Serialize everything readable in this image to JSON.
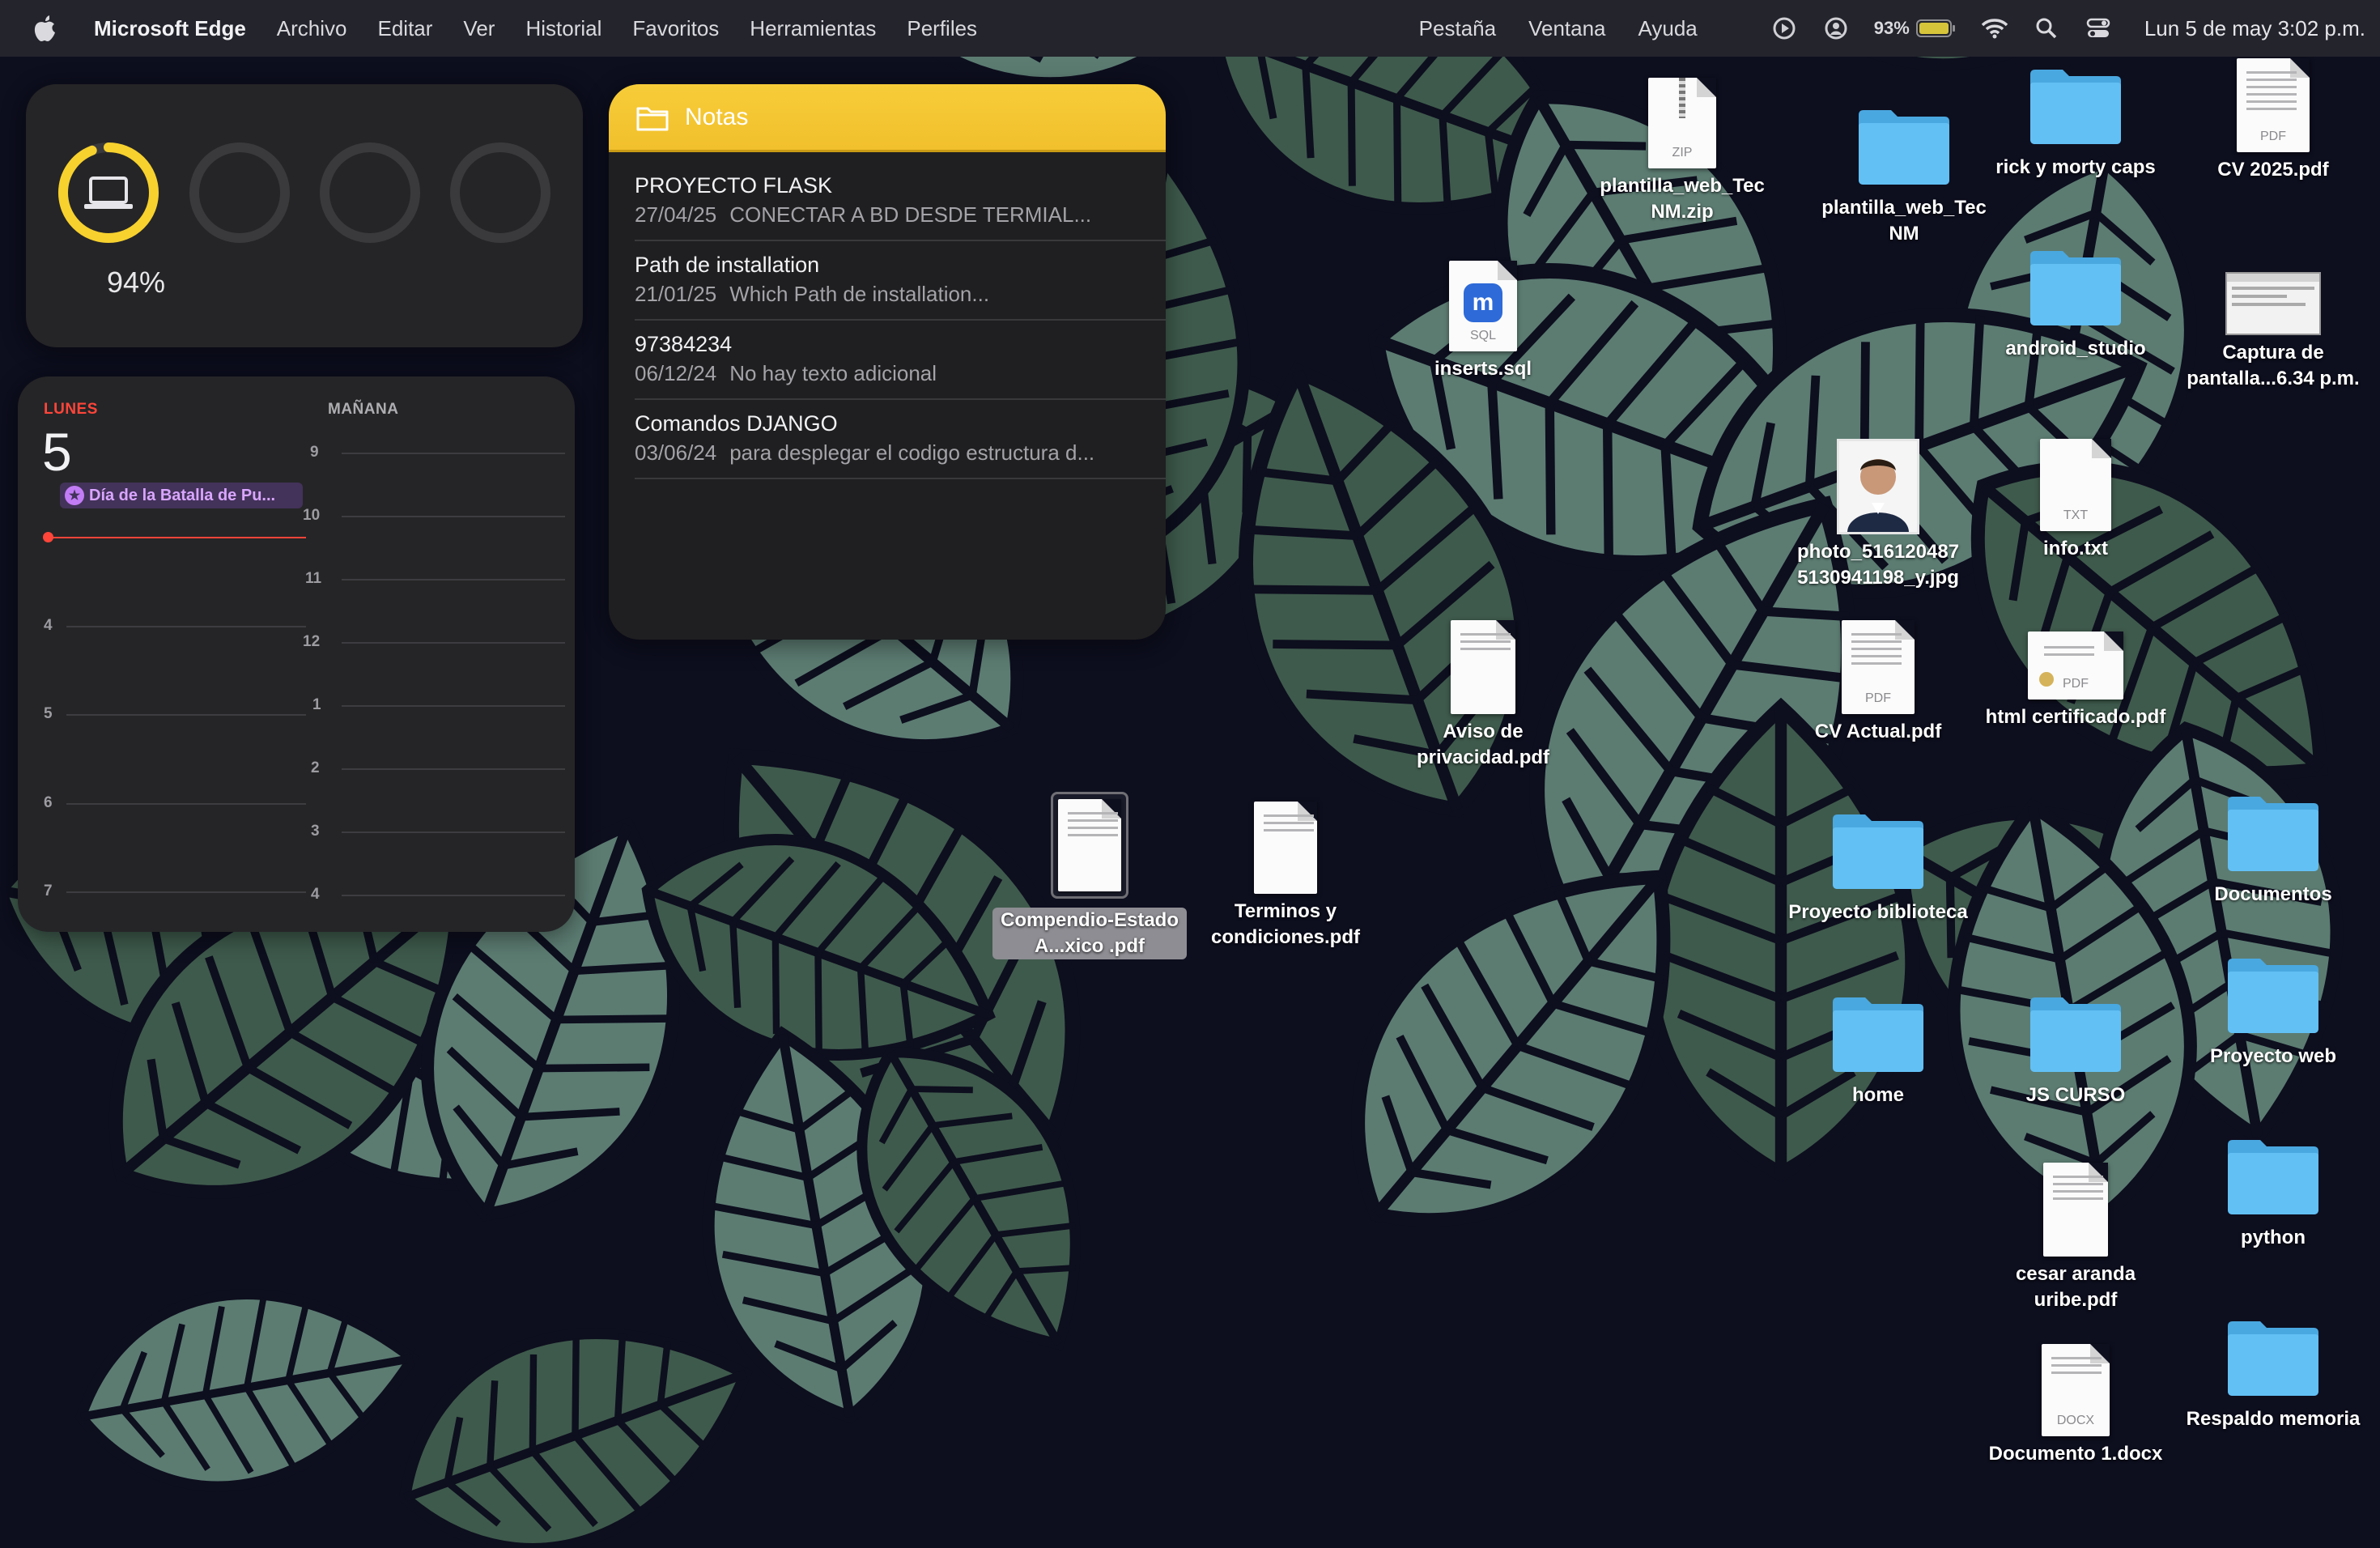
{
  "menubar": {
    "app_name": "Microsoft Edge",
    "menus": [
      "Archivo",
      "Editar",
      "Ver",
      "Historial",
      "Favoritos",
      "Herramientas",
      "Perfiles"
    ],
    "right_menus": [
      "Pestaña",
      "Ventana",
      "Ayuda"
    ],
    "battery_percent": "93%",
    "clock": "Lun 5 de may  3:02 p.m.",
    "icons": [
      "apple-icon",
      "play-icon",
      "user-icon",
      "battery-icon",
      "wifi-icon",
      "search-icon",
      "control-center-icon"
    ]
  },
  "battery_widget": {
    "percent_label": "94%",
    "level": 0.94,
    "ring_color": "#f7d12e"
  },
  "calendar_widget": {
    "today_label": "LUNES",
    "day_number": "5",
    "event": "Día de la Batalla de Pu...",
    "tomorrow_label": "MAÑANA",
    "today_hours": [
      "4",
      "5",
      "6",
      "7"
    ],
    "tomorrow_hours": [
      "9",
      "10",
      "11",
      "12",
      "1",
      "2",
      "3",
      "4"
    ]
  },
  "notes_widget": {
    "title": "Notas",
    "notes": [
      {
        "title": "PROYECTO FLASK",
        "date": "27/04/25",
        "preview": "CONECTAR A BD DESDE TERMIAL..."
      },
      {
        "title": "Path de installation",
        "date": "21/01/25",
        "preview": "Which Path de installation..."
      },
      {
        "title": "97384234",
        "date": "06/12/24",
        "preview": "No hay texto adicional"
      },
      {
        "title": "Comandos DJANGO",
        "date": "03/06/24",
        "preview": "para desplegar el codigo estructura d..."
      }
    ]
  },
  "desktop": {
    "items": [
      {
        "label": "plantilla_web_Tec NM.zip",
        "type": "zip",
        "tag": "ZIP"
      },
      {
        "label": "plantilla_web_Tec NM",
        "type": "folder"
      },
      {
        "label": "rick y morty caps",
        "type": "folder"
      },
      {
        "label": "CV 2025.pdf",
        "type": "pdf",
        "tag": "PDF"
      },
      {
        "label": "inserts.sql",
        "type": "sql",
        "tag": "SQL"
      },
      {
        "label": "android_studio",
        "type": "folder"
      },
      {
        "label": "Captura de pantalla...6.34 p.m.",
        "type": "screenshot"
      },
      {
        "label": "photo_516120487 5130941198_y.jpg",
        "type": "photo"
      },
      {
        "label": "info.txt",
        "type": "txt",
        "tag": "TXT"
      },
      {
        "label": "Aviso de privacidad.pdf",
        "type": "pdf"
      },
      {
        "label": "CV Actual.pdf",
        "type": "pdf",
        "tag": "PDF"
      },
      {
        "label": "html certificado.pdf",
        "type": "pdf",
        "tag": "PDF"
      },
      {
        "label": "Compendio-Estado A...xico .pdf",
        "type": "pdf"
      },
      {
        "label": "Terminos y condiciones.pdf",
        "type": "pdf"
      },
      {
        "label": "Proyecto biblioteca",
        "type": "folder"
      },
      {
        "label": "Documentos",
        "type": "folder"
      },
      {
        "label": "home",
        "type": "folder"
      },
      {
        "label": "JS CURSO",
        "type": "folder"
      },
      {
        "label": "Proyecto web",
        "type": "folder"
      },
      {
        "label": "python",
        "type": "folder"
      },
      {
        "label": "cesar aranda uribe.pdf",
        "type": "pdf"
      },
      {
        "label": "Documento 1.docx",
        "type": "docx",
        "tag": "DOCX"
      },
      {
        "label": "Respaldo memoria",
        "type": "folder"
      }
    ]
  },
  "colors": {
    "folder_blue": "#62c0f5",
    "wallpaper_bg": "#0d0e1e",
    "leaf_green": "#3f5a4d",
    "notes_yellow": "#f6c934",
    "calendar_red": "#ff453a"
  }
}
